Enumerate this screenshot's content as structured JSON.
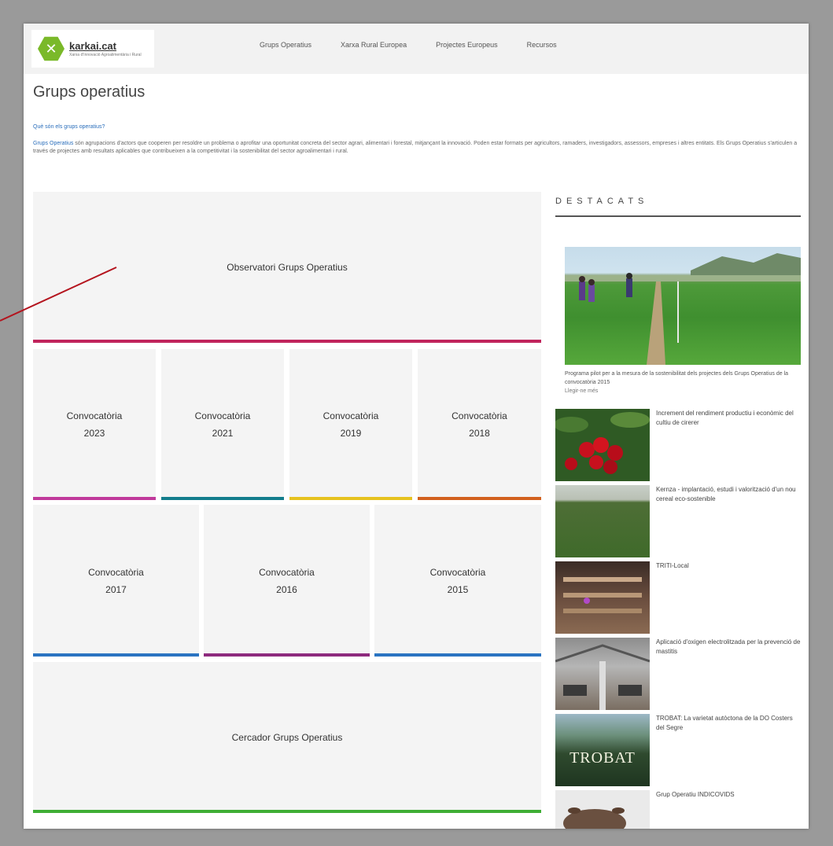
{
  "site": {
    "logo_name": "karkai.cat",
    "logo_sub": "Xarxa d'Innovació Agroalimentària i Rural"
  },
  "nav": {
    "items": [
      "Grups Operatius",
      "Xarxa Rural Europea",
      "Projectes Europeus",
      "Recursos"
    ]
  },
  "page": {
    "title": "Grups operatius",
    "intro_link": "Què són els grups operatius?",
    "intro_lead": "Grups Operatius",
    "intro_body": " són agrupacions d'actors que cooperen per resoldre un problema o aprofitar una oportunitat concreta del sector agrari, alimentari i forestal, mitjançant la innovació. Poden estar formats per agricultors, ramaders, investigadors, assessors, empreses i altres entitats. Els Grups Operatius s'articulen a través de projectes amb resultats aplicables que contribueixen a la competitivitat i la sostenibilitat del sector agroalimentari i rural."
  },
  "tiles": {
    "observatory": "Observatori Grups Operatius",
    "calls": [
      {
        "label": "Convocatòria\n2023",
        "color": "#c0399b"
      },
      {
        "label": "Convocatòria\n2021",
        "color": "#127d8c"
      },
      {
        "label": "Convocatòria\n2019",
        "color": "#e6c21f"
      },
      {
        "label": "Convocatòria\n2018",
        "color": "#d2601e"
      },
      {
        "label": "Convocatòria\n2017",
        "color": "#2a74c2"
      },
      {
        "label": "Convocatòria\n2016",
        "color": "#8e2a7e"
      },
      {
        "label": "Convocatòria\n2015",
        "color": "#2a74c2"
      }
    ],
    "search": "Cercador Grups Operatius",
    "observatory_color": "#c0245c",
    "search_color": "#3fae35"
  },
  "sidebar": {
    "heading": "DESTACATS",
    "feature_caption": "Programa pilot per a la mesura de la sostenibilitat dels projectes dels Grups Operatius de la convocatòria 2015",
    "feature_more": "Llegir-ne més",
    "news": [
      "Increment del rendiment productiu i econòmic del cultiu de cirerer",
      "Kernza - implantació, estudi i valorització d'un nou cereal eco-sostenible",
      "TRITI-Local",
      "Aplicació d'oxigen electrolitzada per la prevenció de mastitis",
      "TROBAT: La varietat autòctona de la DO Costers del Segre",
      "Grup Operatiu INDICOVIDS"
    ],
    "news_thumb_text": "TROBAT"
  }
}
